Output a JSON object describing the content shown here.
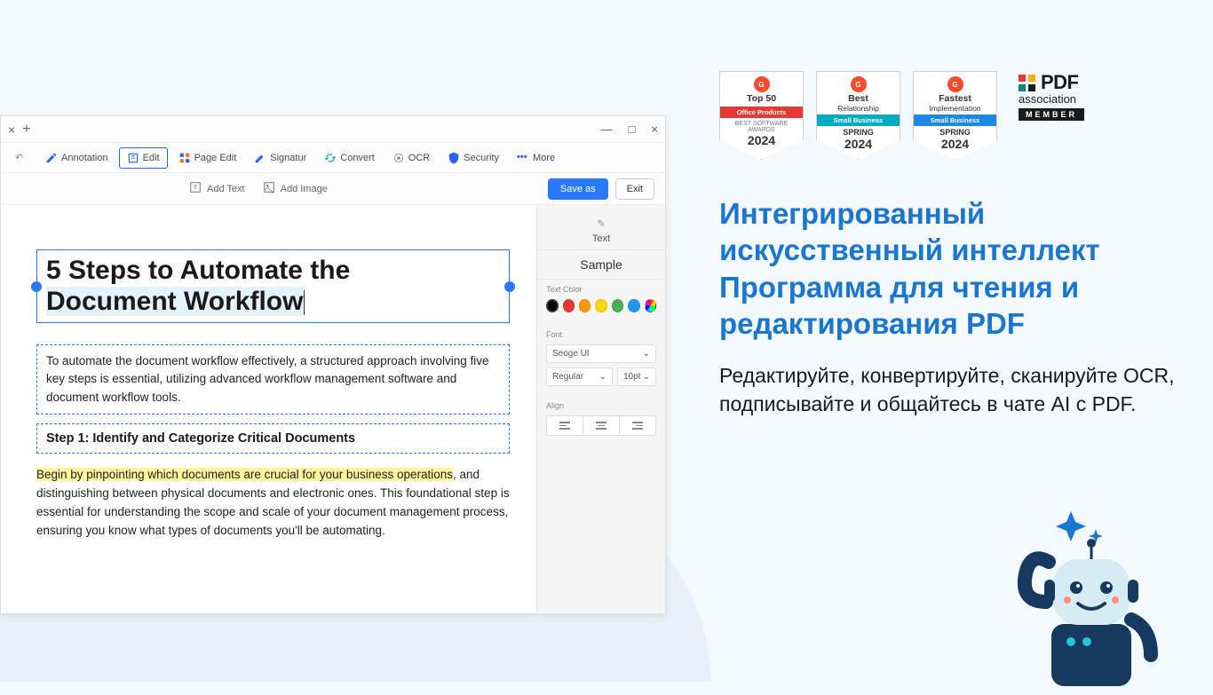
{
  "window": {
    "controls": {
      "minimize": "—",
      "maximize": "□",
      "close": "×"
    }
  },
  "toolbar": {
    "annotation": "Annotation",
    "edit": "Edit",
    "page_edit": "Page Edit",
    "signatur": "Signatur",
    "convert": "Convert",
    "ocr": "OCR",
    "security": "Security",
    "more": "More"
  },
  "subtoolbar": {
    "add_text": "Add Text",
    "add_image": "Add Image",
    "save_as": "Save as",
    "exit": "Exit"
  },
  "document": {
    "title_line1": "5 Steps to Automate the",
    "title_line2": "Document Workflow",
    "intro": "To automate the document workflow effectively, a structured approach involving five key steps is essential, utilizing advanced workflow management software and document workflow tools.",
    "step1_heading": "Step 1: Identify and Categorize Critical Documents",
    "body_highlight": "Begin by pinpointing which documents are crucial for your business operations",
    "body_rest": ", and distinguishing between physical documents and electronic ones. This foundational step is essential for understanding the scope and scale of your document management process, ensuring you know what types of documents you'll be automating."
  },
  "panel": {
    "text_label": "Text",
    "sample": "Sample",
    "text_color": "Text Color",
    "font": "Font",
    "font_family": "Seoge UI",
    "font_weight": "Regular",
    "font_size": "10pt",
    "align": "Align",
    "colors": [
      "#000000",
      "#e53935",
      "#ff9800",
      "#ffd600",
      "#4caf50",
      "#2196f3",
      "#9c27b0"
    ]
  },
  "badges": [
    {
      "line1": "Top 50",
      "line2": "",
      "stripe": "Office Products",
      "stripe_class": "stripe-red",
      "sub": "BEST SOFTWARE AWARDS",
      "season": "",
      "year": "2024"
    },
    {
      "line1": "Best",
      "line2": "Relationship",
      "stripe": "Small Business",
      "stripe_class": "stripe-teal",
      "sub": "",
      "season": "SPRING",
      "year": "2024"
    },
    {
      "line1": "Fastest",
      "line2": "Implementation",
      "stripe": "Small Business",
      "stripe_class": "stripe-blue",
      "sub": "",
      "season": "SPRING",
      "year": "2024"
    }
  ],
  "pdf_assoc": {
    "pdf": "PDF",
    "assoc": "association",
    "member": "MEMBER"
  },
  "marketing": {
    "headline": "Интегрированный искусственный интеллект Программа для чтения и редактирования PDF",
    "subhead": "Редактируйте, конвертируйте, сканируйте OCR, подписывайте и общайтесь в чате AI с PDF."
  }
}
